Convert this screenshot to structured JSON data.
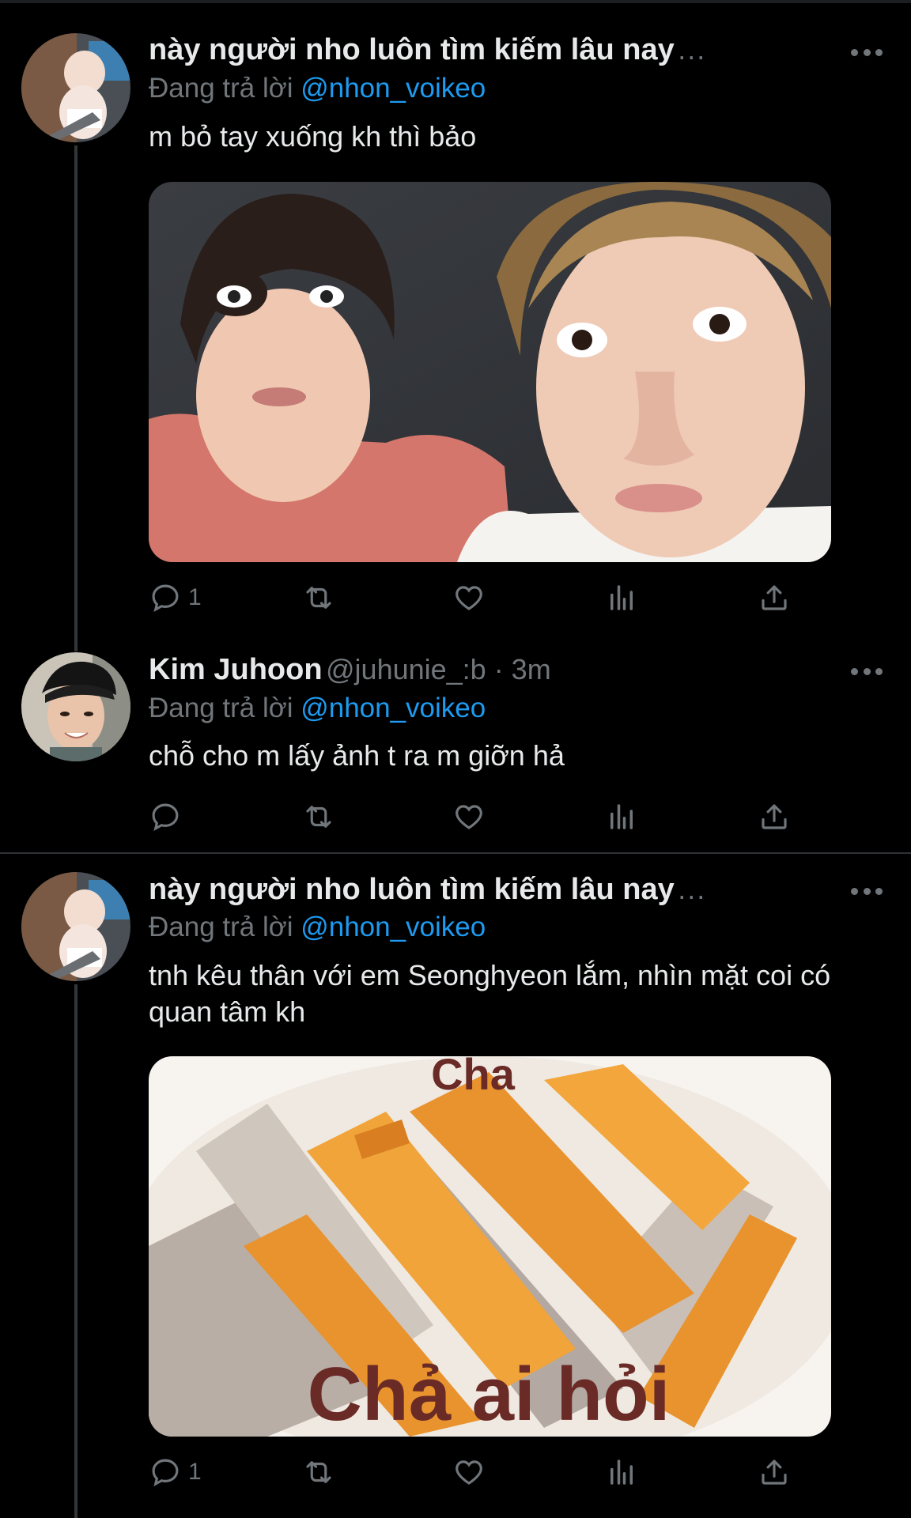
{
  "tweets": [
    {
      "display_name": "này người nho luôn tìm kiếm lâu nay",
      "name_truncation": "...",
      "handle_meta": "",
      "reply_prefix": "Đang trả lời",
      "reply_mention": "@nhon_voikeo",
      "text": "m bỏ tay xuống kh thì bảo",
      "actions": {
        "replies": "1",
        "retweets": "",
        "likes": ""
      }
    },
    {
      "display_name": "Kim Juhoon",
      "name_truncation": "",
      "handle_meta": "@juhunie_:b · 3m",
      "reply_prefix": "Đang trả lời",
      "reply_mention": "@nhon_voikeo",
      "text": "chỗ cho m lấy ảnh t ra m giỡn hả",
      "actions": {
        "replies": "",
        "retweets": "",
        "likes": ""
      }
    },
    {
      "display_name": "này người nho luôn tìm kiếm lâu nay",
      "name_truncation": "...",
      "handle_meta": "",
      "reply_prefix": "Đang trả lời",
      "reply_mention": "@nhon_voikeo",
      "text": "tnh kêu thân với em Seonghyeon lắm, nhìn mặt coi có quan tâm kh",
      "actions": {
        "replies": "1",
        "retweets": "",
        "likes": ""
      },
      "media_caption_top": "Cha",
      "media_caption_bottom": "Chả ai hỏi"
    }
  ],
  "colors": {
    "background": "#000000",
    "text_primary": "#e7e9ea",
    "text_secondary": "#71767b",
    "mention": "#1d9bf0",
    "divider": "#2f3336"
  },
  "icons": [
    "reply-icon",
    "retweet-icon",
    "like-icon",
    "views-icon",
    "share-icon",
    "more-icon"
  ]
}
